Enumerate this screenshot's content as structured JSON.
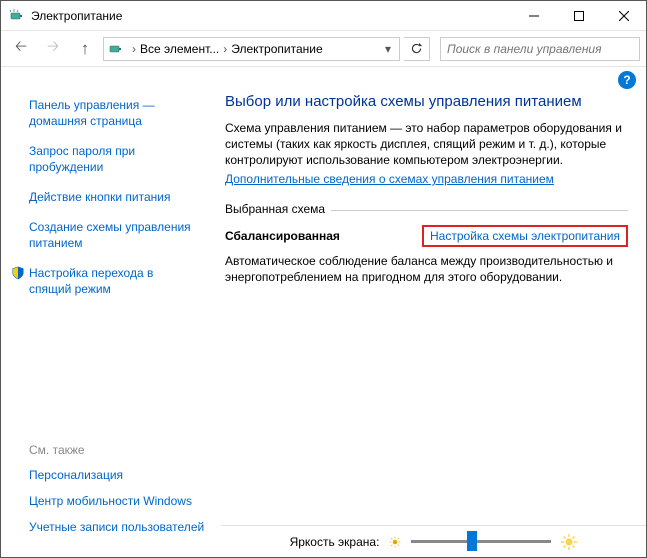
{
  "window": {
    "title": "Электропитание"
  },
  "address": {
    "part1": "Все элемент...",
    "part2": "Электропитание"
  },
  "search": {
    "placeholder": "Поиск в панели управления"
  },
  "sidebar": {
    "links": [
      "Панель управления — домашняя страница",
      "Запрос пароля при пробуждении",
      "Действие кнопки питания",
      "Создание схемы управления питанием",
      "Настройка перехода в спящий режим"
    ]
  },
  "main": {
    "heading": "Выбор или настройка схемы управления питанием",
    "description": "Схема управления питанием — это набор параметров оборудования и системы (таких как яркость дисплея, спящий режим и т. д.), которые контролируют использование компьютером электроэнергии.",
    "more_link": "Дополнительные сведения о схемах управления питанием",
    "group_label": "Выбранная схема",
    "plan_name": "Сбалансированная",
    "plan_link": "Настройка схемы электропитания",
    "plan_desc": "Автоматическое соблюдение баланса между производительностью и энергопотреблением на пригодном для этого оборудовании."
  },
  "footer": {
    "see_also": "См. также",
    "links": [
      "Персонализация",
      "Центр мобильности Windows",
      "Учетные записи пользователей"
    ]
  },
  "brightness": {
    "label": "Яркость экрана:"
  }
}
